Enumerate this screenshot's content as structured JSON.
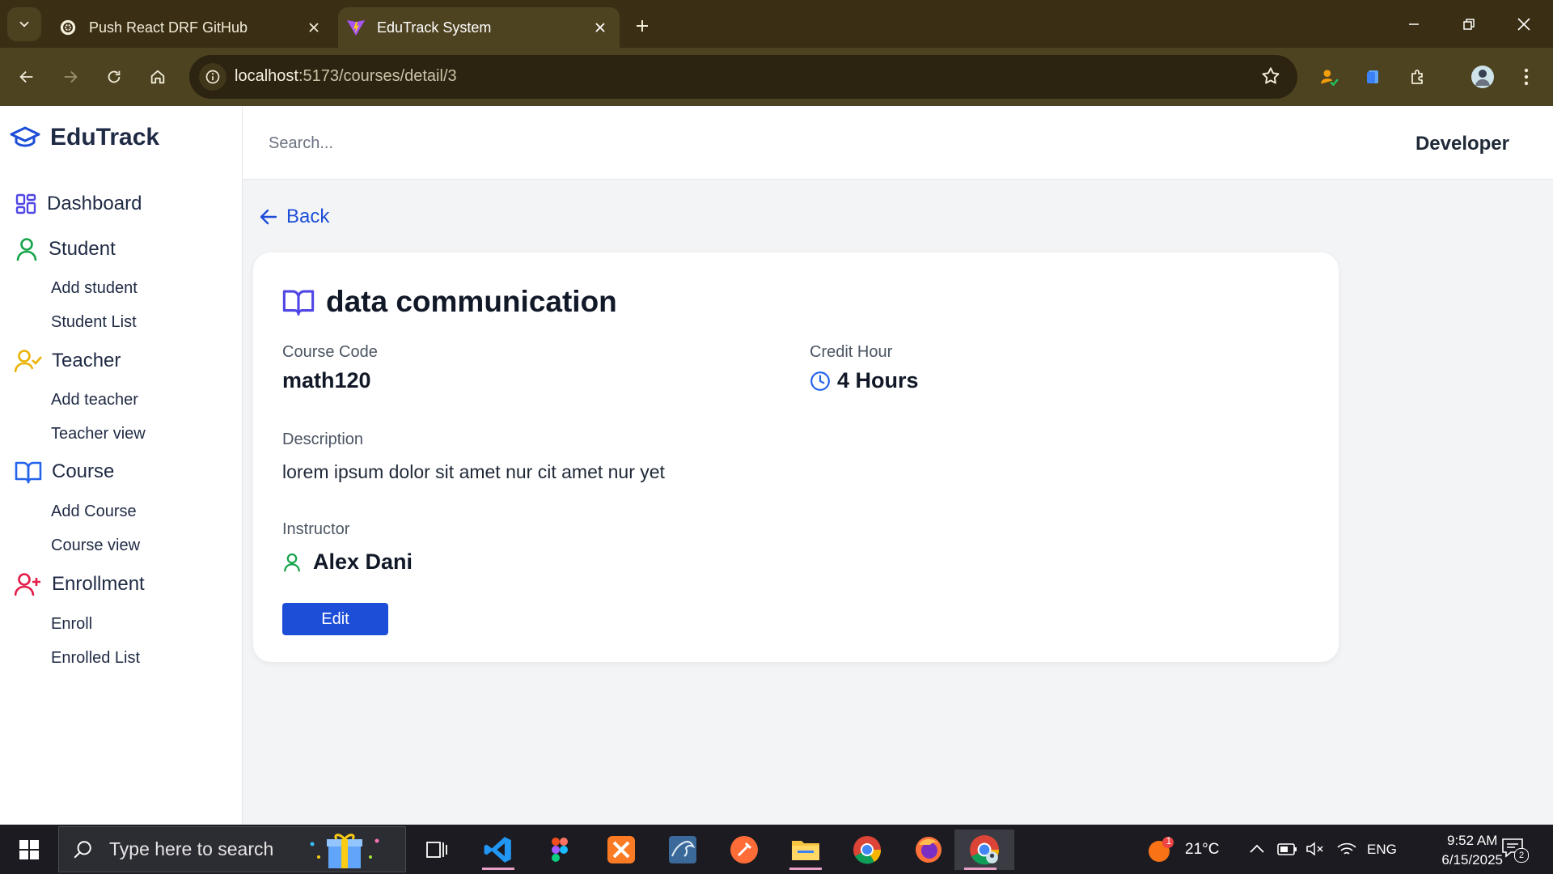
{
  "browser": {
    "tabs": [
      {
        "title": "Push React DRF GitHub",
        "icon": "openai-icon",
        "active": false
      },
      {
        "title": "EduTrack System",
        "icon": "vite-icon",
        "active": true
      }
    ],
    "url_host": "localhost",
    "url_path": ":5173/courses/detail/3"
  },
  "app": {
    "brand": "EduTrack",
    "search_placeholder": "Search...",
    "user": "Developer"
  },
  "sidebar": {
    "dashboard": "Dashboard",
    "student": {
      "label": "Student",
      "items": [
        "Add student",
        "Student List"
      ]
    },
    "teacher": {
      "label": "Teacher",
      "items": [
        "Add teacher",
        "Teacher view"
      ]
    },
    "course": {
      "label": "Course",
      "items": [
        "Add Course",
        "Course view"
      ]
    },
    "enrollment": {
      "label": "Enrollment",
      "items": [
        "Enroll",
        "Enrolled List"
      ]
    }
  },
  "colors": {
    "brand_blue": "#1d4ed8",
    "dashboard_icon": "#4f46e5",
    "student_icon": "#16a34a",
    "teacher_icon": "#eab308",
    "course_icon": "#2563eb",
    "enrollment_icon": "#e11d48"
  },
  "main": {
    "back_label": "Back",
    "course": {
      "title": "data communication",
      "code_label": "Course Code",
      "code": "math120",
      "credit_label": "Credit Hour",
      "credit": "4 Hours",
      "description_label": "Description",
      "description": "lorem ipsum dolor sit amet nur cit amet nur yet",
      "instructor_label": "Instructor",
      "instructor": "Alex Dani"
    },
    "edit_label": "Edit"
  },
  "taskbar": {
    "search_placeholder": "Type here to search",
    "weather": "21°C",
    "weather_badge": "1",
    "language": "ENG",
    "time": "9:52 AM",
    "date": "6/15/2025",
    "notifications": "2"
  }
}
